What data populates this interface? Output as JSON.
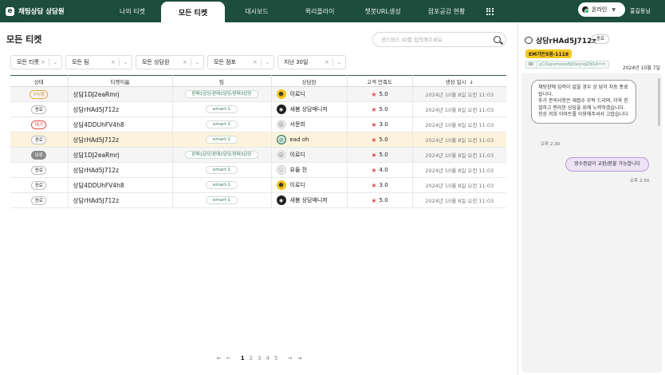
{
  "app": {
    "brand": "채팅상담 상담원",
    "nav": [
      "나의 티켓",
      "모든 티켓",
      "대시보드",
      "퀵리플라이",
      "챗봇URL생성",
      "점포공감 현황"
    ],
    "active_nav": 1,
    "status_label": "온라인",
    "user_name": "홍길동님"
  },
  "main": {
    "title": "모든 티켓",
    "search_placeholder": "샌드버드 ID를 입력해주세요",
    "filters": [
      "모든 티켓",
      "모든 팀",
      "모든 상담원",
      "모든 점포",
      "지난 30일"
    ],
    "columns": [
      "상태",
      "티켓이름",
      "팀",
      "상담원",
      "고객 만족도",
      "생성 일시"
    ],
    "sort_indicator": "↓",
    "rows": [
      {
        "status": "상담중",
        "status_type": "progress",
        "name": "상담1DJ2eaRmrj",
        "team": "판매1담당/판매2담당/판매3담당",
        "agent": "이로디",
        "avatar": "yellow",
        "score": "5.0",
        "date": "2024년 10월 8일 오전 11:03"
      },
      {
        "status": "종료",
        "status_type": "done",
        "name": "상담rHAd5J712z",
        "team": "emart-1",
        "agent": "새봄 상담매니저",
        "avatar": "dark",
        "score": "5.0",
        "date": "2024년 10월 8일 오전 11:03"
      },
      {
        "status": "대기",
        "status_type": "wait",
        "name": "상담4DDUhFV4h8",
        "team": "emart-1",
        "agent": "서문희",
        "avatar": "gray",
        "score": "3.0",
        "date": "2024년 10월 8일 오전 11:03"
      },
      {
        "status": "종료",
        "status_type": "done",
        "name": "상담rHAd5J712z",
        "team": "emart-1",
        "agent": "ead oh",
        "avatar": "teal",
        "score": "5.0",
        "date": "2024년 10월 8일 오전 11:03"
      },
      {
        "status": "보류",
        "status_type": "hold",
        "name": "상담1DJ2eaRmrj",
        "team": "판매1담당/판매2담당/판매3담당",
        "agent": "이로디",
        "avatar": "gray",
        "score": "5.0",
        "date": "2024년 10월 8일 오전 11:03"
      },
      {
        "status": "종료",
        "status_type": "done",
        "name": "상담rHAd5J712z",
        "team": "emart-1",
        "agent": "유들 전",
        "avatar": "light",
        "score": "4.0",
        "date": "2024년 10월 8일 오전 11:03"
      },
      {
        "status": "종료",
        "status_type": "done",
        "name": "상담4DDUhFV4h8",
        "team": "emart-1",
        "agent": "이로디",
        "avatar": "yellow",
        "score": "3.0",
        "date": "2024년 10월 8일 오전 11:03"
      },
      {
        "status": "종료",
        "status_type": "done",
        "name": "상담rHAd5J712z",
        "team": "emart-1",
        "agent": "새봄 상담매니저",
        "avatar": "dark",
        "score": "5.0",
        "date": "2024년 10월 8일 오전 11:03"
      }
    ],
    "highlight_row": 3,
    "alt_rows": [
      0,
      4
    ],
    "pager": {
      "pages": [
        "1",
        "2",
        "3",
        "4",
        "5"
      ],
      "current": "1",
      "first": "⇤",
      "prev": "←",
      "next": "→",
      "last": "⇥"
    }
  },
  "side": {
    "title": "상담rHAd5J712z",
    "close_label": "종료",
    "tag": "EM가든5점-1118",
    "id_label": "ID",
    "id_value": "yCXapxmesoNjDeynqZN1A==",
    "date": "2024년 10월 7일",
    "msg_in": "채팅창에 입력이 없을 경우 상 담이 자동 종료됩니다.\n추가 문의사항은 재접수 부탁 드리며, 더욱 친절하고 편리한 상담을 위해 노력하겠습니다.\n항상 저희 이마트를 이용해주셔서 고맙습니다",
    "msg_in_time": "오후 2:30",
    "msg_out": "영수증없이 교환/환불 가능합니다",
    "msg_out_time": "오후 2:30"
  }
}
